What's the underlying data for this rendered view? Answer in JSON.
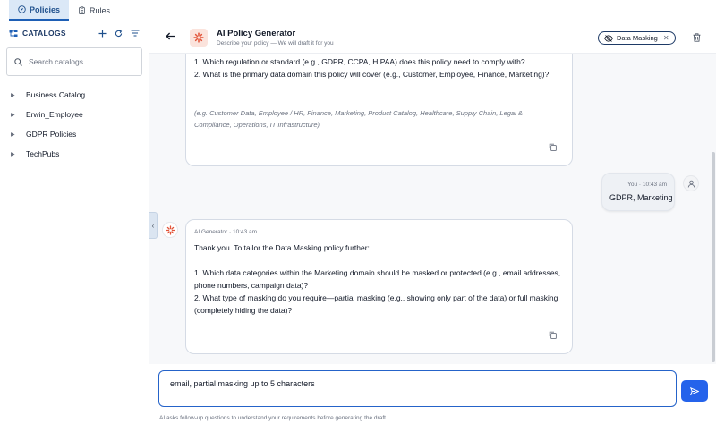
{
  "sidebar": {
    "tabs": [
      {
        "label": "Policies",
        "icon": "compass-icon",
        "active": true
      },
      {
        "label": "Rules",
        "icon": "clipboard-icon",
        "active": false
      }
    ],
    "catalogs_title": "CATALOGS",
    "search_placeholder": "Search catalogs...",
    "items": [
      {
        "label": "Business Catalog"
      },
      {
        "label": "Erwin_Employee"
      },
      {
        "label": "GDPR Policies"
      },
      {
        "label": "TechPubs"
      }
    ]
  },
  "header": {
    "title": "AI Policy Generator",
    "subtitle": "Describe your policy — We will draft it for you",
    "tag": "Data Masking"
  },
  "messages": {
    "ai_first": {
      "lines": [
        "1. Which regulation or standard (e.g., GDPR, CCPA, HIPAA) does this policy need to comply with?",
        "2. What is the primary data domain this policy will cover (e.g., Customer, Employee, Finance, Marketing)?"
      ],
      "hint": "(e.g. Customer Data, Employee / HR, Finance, Marketing, Product Catalog, Healthcare, Supply Chain, Legal & Compliance, Operations, IT Infrastructure)"
    },
    "user": {
      "meta": "You · 10:43 am",
      "text": "GDPR, Marketing"
    },
    "ai_second": {
      "meta": "AI Generator · 10:43 am",
      "lines": [
        "Thank you. To tailor the Data Masking policy further:",
        "",
        "1. Which data categories within the Marketing domain should be masked or protected (e.g., email addresses, phone numbers, campaign data)?",
        "2. What type of masking do you require—partial masking (e.g., showing only part of the data) or full masking (completely hiding the data)?"
      ]
    }
  },
  "composer": {
    "value": "email, partial masking up to 5 characters",
    "footnote": "AI asks follow-up questions to understand your requirements before generating the draft."
  },
  "colors": {
    "accent": "#2563eb",
    "brand": "#e2553a",
    "active_tab_bg": "#dbe8f7"
  }
}
